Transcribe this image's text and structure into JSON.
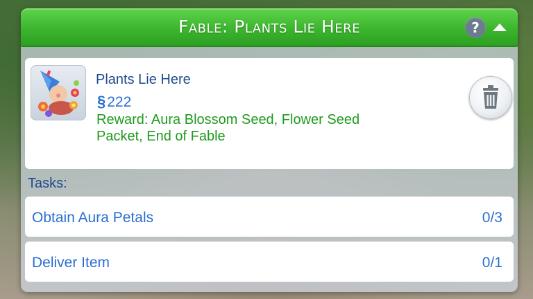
{
  "header": {
    "title": "Fable: Plants Lie Here",
    "help_symbol": "?",
    "accent_color": "#3bb52d"
  },
  "fable": {
    "name": "Plants Lie Here",
    "currency_symbol": "§",
    "reward_amount": "222",
    "reward_text": "Reward: Aura Blossom Seed, Flower Seed Packet, End of Fable",
    "thumbnail_icon": "gnome-with-flowers-icon",
    "delete_icon": "trash-icon"
  },
  "tasks": {
    "header": "Tasks:",
    "items": [
      {
        "name": "Obtain Aura Petals",
        "progress": "0/3"
      },
      {
        "name": "Deliver Item",
        "progress": "0/1"
      }
    ]
  }
}
